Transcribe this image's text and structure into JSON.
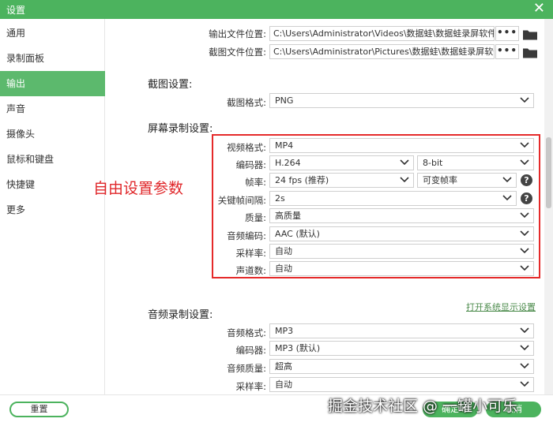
{
  "window": {
    "title": "设置",
    "close_icon": "close-icon"
  },
  "sidebar": {
    "items": [
      {
        "label": "通用"
      },
      {
        "label": "录制面板"
      },
      {
        "label": "输出",
        "active": true
      },
      {
        "label": "声音"
      },
      {
        "label": "摄像头"
      },
      {
        "label": "鼠标和键盘"
      },
      {
        "label": "快捷键"
      },
      {
        "label": "更多"
      }
    ]
  },
  "output": {
    "file_location_label": "输出文件位置:",
    "file_location_value": "C:\\Users\\Administrator\\Videos\\数据蛙\\数据蛙录屏软件",
    "screenshot_location_label": "截图文件位置:",
    "screenshot_location_value": "C:\\Users\\Administrator\\Pictures\\数据蛙\\数据蛙录屏软件",
    "browse_label": "•••"
  },
  "screenshot_settings": {
    "heading": "截图设置:",
    "format_label": "截图格式:",
    "format_value": "PNG"
  },
  "screen_recording": {
    "heading": "屏幕录制设置:",
    "video_format_label": "视频格式:",
    "video_format_value": "MP4",
    "encoder_label": "编码器:",
    "encoder_value": "H.264",
    "bit_depth_value": "8-bit",
    "frame_rate_label": "帧率:",
    "frame_rate_value": "24 fps (推荐)",
    "frame_mode_value": "可变帧率",
    "keyframe_label": "关键帧间隔:",
    "keyframe_value": "2s",
    "quality_label": "质量:",
    "quality_value": "高质量",
    "audio_codec_label": "音频编码:",
    "audio_codec_value": "AAC (默认)",
    "sample_rate_label": "采样率:",
    "sample_rate_value": "自动",
    "channels_label": "声道数:",
    "channels_value": "自动",
    "system_display_link": "打开系统显示设置"
  },
  "annotation": {
    "text": "自由设置参数",
    "color": "#e0272a"
  },
  "audio_recording": {
    "heading": "音频录制设置:",
    "format_label": "音频格式:",
    "format_value": "MP3",
    "encoder_label": "编码器:",
    "encoder_value": "MP3 (默认)",
    "quality_label": "音频质量:",
    "quality_value": "超高",
    "sample_rate_label": "采样率:",
    "sample_rate_value": "自动"
  },
  "footer": {
    "reset_label": "重置",
    "ok_label": "确定",
    "cancel_label": "取消"
  },
  "watermark": "掘金技术社区 @ 一罐小可乐",
  "colors": {
    "accent": "#4cb35e",
    "highlight": "#e52a2a"
  }
}
